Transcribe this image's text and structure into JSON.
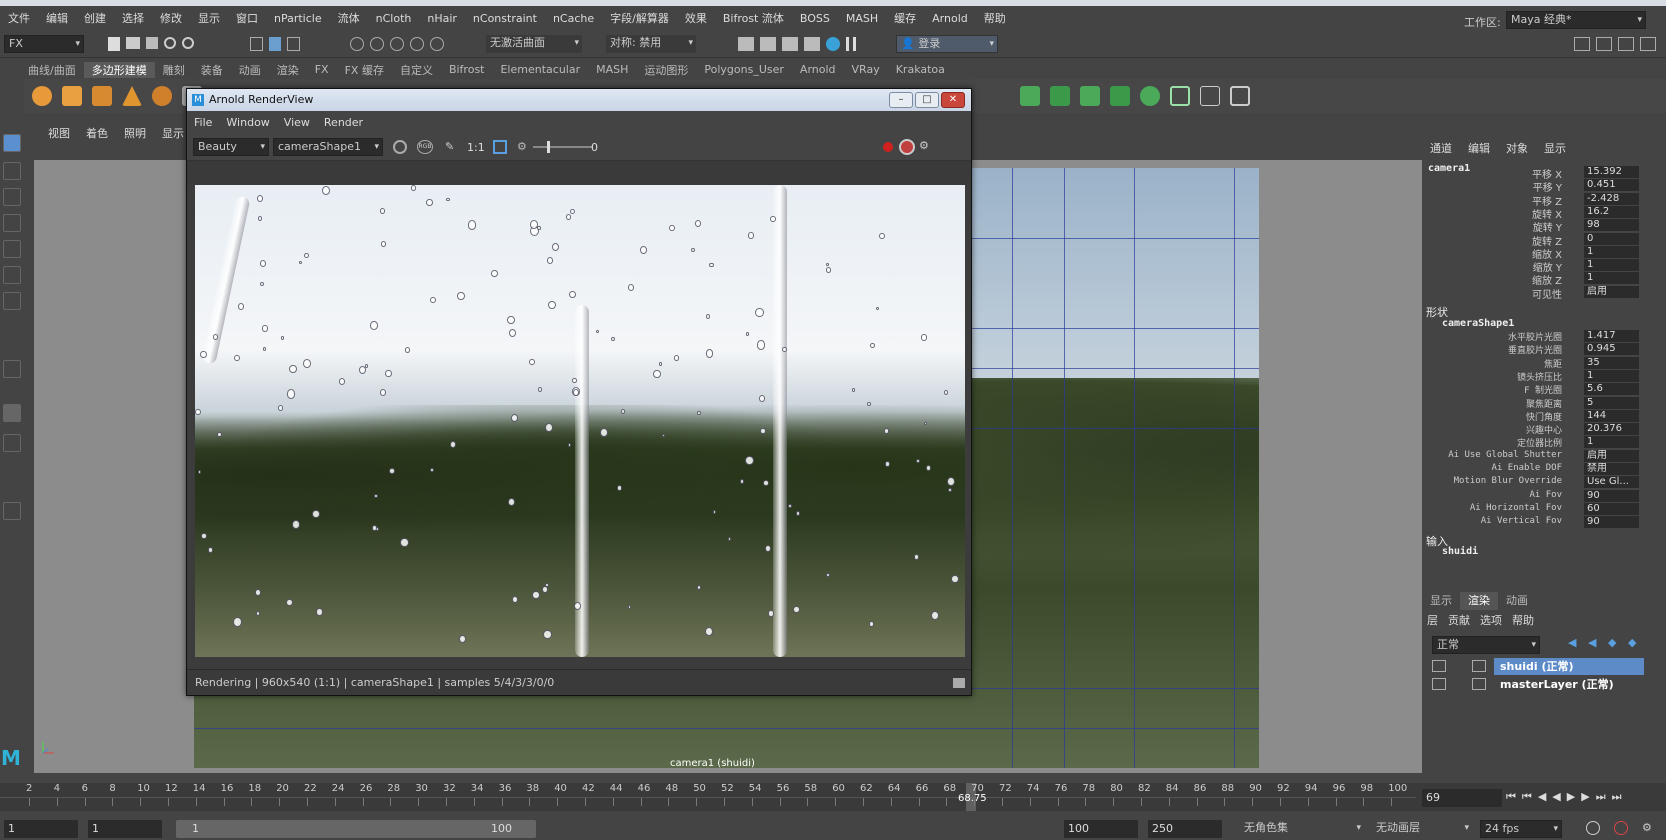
{
  "menubar": [
    "文件",
    "编辑",
    "创建",
    "选择",
    "修改",
    "显示",
    "窗口",
    "nParticle",
    "流体",
    "nCloth",
    "nHair",
    "nConstraint",
    "nCache",
    "字段/解算器",
    "效果",
    "Bifrost 流体",
    "BOSS",
    "MASH",
    "缓存",
    "Arnold",
    "帮助"
  ],
  "toolbar": {
    "mode": "FX",
    "live_surface": "无激活曲面",
    "symmetry": "对称: 禁用",
    "login": "登录",
    "workspace_label": "工作区:",
    "workspace": "Maya 经典*"
  },
  "shelf_tabs": [
    "曲线/曲面",
    "多边形建模",
    "雕刻",
    "装备",
    "动画",
    "渲染",
    "FX",
    "FX 缓存",
    "自定义",
    "Bifrost",
    "Elementacular",
    "MASH",
    "运动图形",
    "Polygons_User",
    "Arnold",
    "VRay",
    "Krakatoa"
  ],
  "shelf_active": "多边形建模",
  "viewport": {
    "menu": [
      "视图",
      "着色",
      "照明",
      "显示"
    ],
    "camera_label": "camera1 (shuidi)"
  },
  "renderview": {
    "title": "Arnold RenderView",
    "menu": [
      "File",
      "Window",
      "View",
      "Render"
    ],
    "aov": "Beauty",
    "camera": "cameraShape1",
    "ratio": "1:1",
    "exposure": "0",
    "status": "Rendering  |  960x540 (1:1)  |  cameraShape1   |  samples 5/4/3/3/0/0"
  },
  "attr": {
    "tabs": [
      "通道",
      "编辑",
      "对象",
      "显示"
    ],
    "object": "camera1",
    "transform": [
      {
        "label": "平移 X",
        "value": "15.392"
      },
      {
        "label": "平移 Y",
        "value": "0.451"
      },
      {
        "label": "平移 Z",
        "value": "-2.428"
      },
      {
        "label": "旋转 X",
        "value": "16.2"
      },
      {
        "label": "旋转 Y",
        "value": "98"
      },
      {
        "label": "旋转 Z",
        "value": "0"
      },
      {
        "label": "缩放 X",
        "value": "1"
      },
      {
        "label": "缩放 Y",
        "value": "1"
      },
      {
        "label": "缩放 Z",
        "value": "1"
      },
      {
        "label": "可见性",
        "value": "启用"
      }
    ],
    "shapes_header": "形状",
    "shape_name": "cameraShape1",
    "shape": [
      {
        "label": "水平胶片光圈",
        "value": "1.417"
      },
      {
        "label": "垂直胶片光圈",
        "value": "0.945"
      },
      {
        "label": "焦距",
        "value": "35"
      },
      {
        "label": "镜头挤压比",
        "value": "1"
      },
      {
        "label": "F 制光圈",
        "value": "5.6"
      },
      {
        "label": "聚焦距离",
        "value": "5"
      },
      {
        "label": "快门角度",
        "value": "144"
      },
      {
        "label": "兴趣中心",
        "value": "20.376"
      },
      {
        "label": "定位器比例",
        "value": "1"
      },
      {
        "label": "Ai Use Global Shutter",
        "value": "启用"
      },
      {
        "label": "Ai Enable DOF",
        "value": "禁用"
      },
      {
        "label": "Motion Blur Override",
        "value": "Use Gl..."
      },
      {
        "label": "Ai Fov",
        "value": "90"
      },
      {
        "label": "Ai Horizontal Fov",
        "value": "60"
      },
      {
        "label": "Ai Vertical Fov",
        "value": "90"
      }
    ],
    "inputs_header": "输入",
    "input_name": "shuidi"
  },
  "layers": {
    "tabs": [
      "显示",
      "渲染",
      "动画"
    ],
    "active_tab": "渲染",
    "menu": [
      "层",
      "贡献",
      "选项",
      "帮助"
    ],
    "mode": "正常",
    "items": [
      "shuidi (正常)",
      "masterLayer (正常)"
    ]
  },
  "timeline": {
    "ticks": [
      "2",
      "4",
      "6",
      "8",
      "10",
      "12",
      "14",
      "16",
      "18",
      "20",
      "22",
      "24",
      "26",
      "28",
      "30",
      "32",
      "34",
      "36",
      "38",
      "40",
      "42",
      "44",
      "46",
      "48",
      "50",
      "52",
      "54",
      "56",
      "58",
      "60",
      "62",
      "64",
      "66",
      "68",
      "70",
      "72",
      "74",
      "76",
      "78",
      "80",
      "82",
      "84",
      "86",
      "88",
      "90",
      "92",
      "94",
      "96",
      "98",
      "100"
    ],
    "playhead": "68.75",
    "current_frame": "69"
  },
  "range": {
    "start": "1",
    "anim_start": "1",
    "slider_start": "1",
    "slider_end": "100",
    "end": "100",
    "anim_end": "250",
    "char_set": "无角色集",
    "anim_layer": "无动画层",
    "fps": "24 fps"
  }
}
